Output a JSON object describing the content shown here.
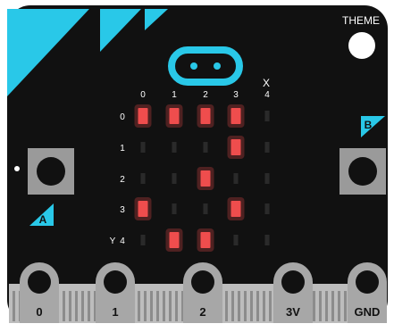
{
  "theme_button": {
    "label": "THEME"
  },
  "colors": {
    "board": "#111111",
    "accent": "#29c8e8",
    "led_on": "#ef4d4d",
    "led_off": "#2a2a2a",
    "button_body": "#9a9a9a",
    "pin_metal": "#bdbdbd"
  },
  "axes": {
    "x_title": "X",
    "y_title": "Y",
    "col_labels": [
      "0",
      "1",
      "2",
      "3",
      "4"
    ],
    "row_labels": [
      "0",
      "1",
      "2",
      "3",
      "4"
    ]
  },
  "buttons": {
    "a_label": "A",
    "b_label": "B"
  },
  "led_matrix": [
    [
      1,
      1,
      1,
      1,
      0
    ],
    [
      0,
      0,
      0,
      1,
      0
    ],
    [
      0,
      0,
      1,
      0,
      0
    ],
    [
      1,
      0,
      0,
      1,
      0
    ],
    [
      0,
      1,
      1,
      0,
      0
    ]
  ],
  "pins": [
    {
      "label": "0"
    },
    {
      "label": "1"
    },
    {
      "label": "2"
    },
    {
      "label": "3V"
    },
    {
      "label": "GND"
    }
  ],
  "icons": {
    "logo": "microbit-logo-icon",
    "theme": "theme-circle-icon",
    "button_a": "button-a-icon",
    "button_b": "button-b-icon"
  }
}
